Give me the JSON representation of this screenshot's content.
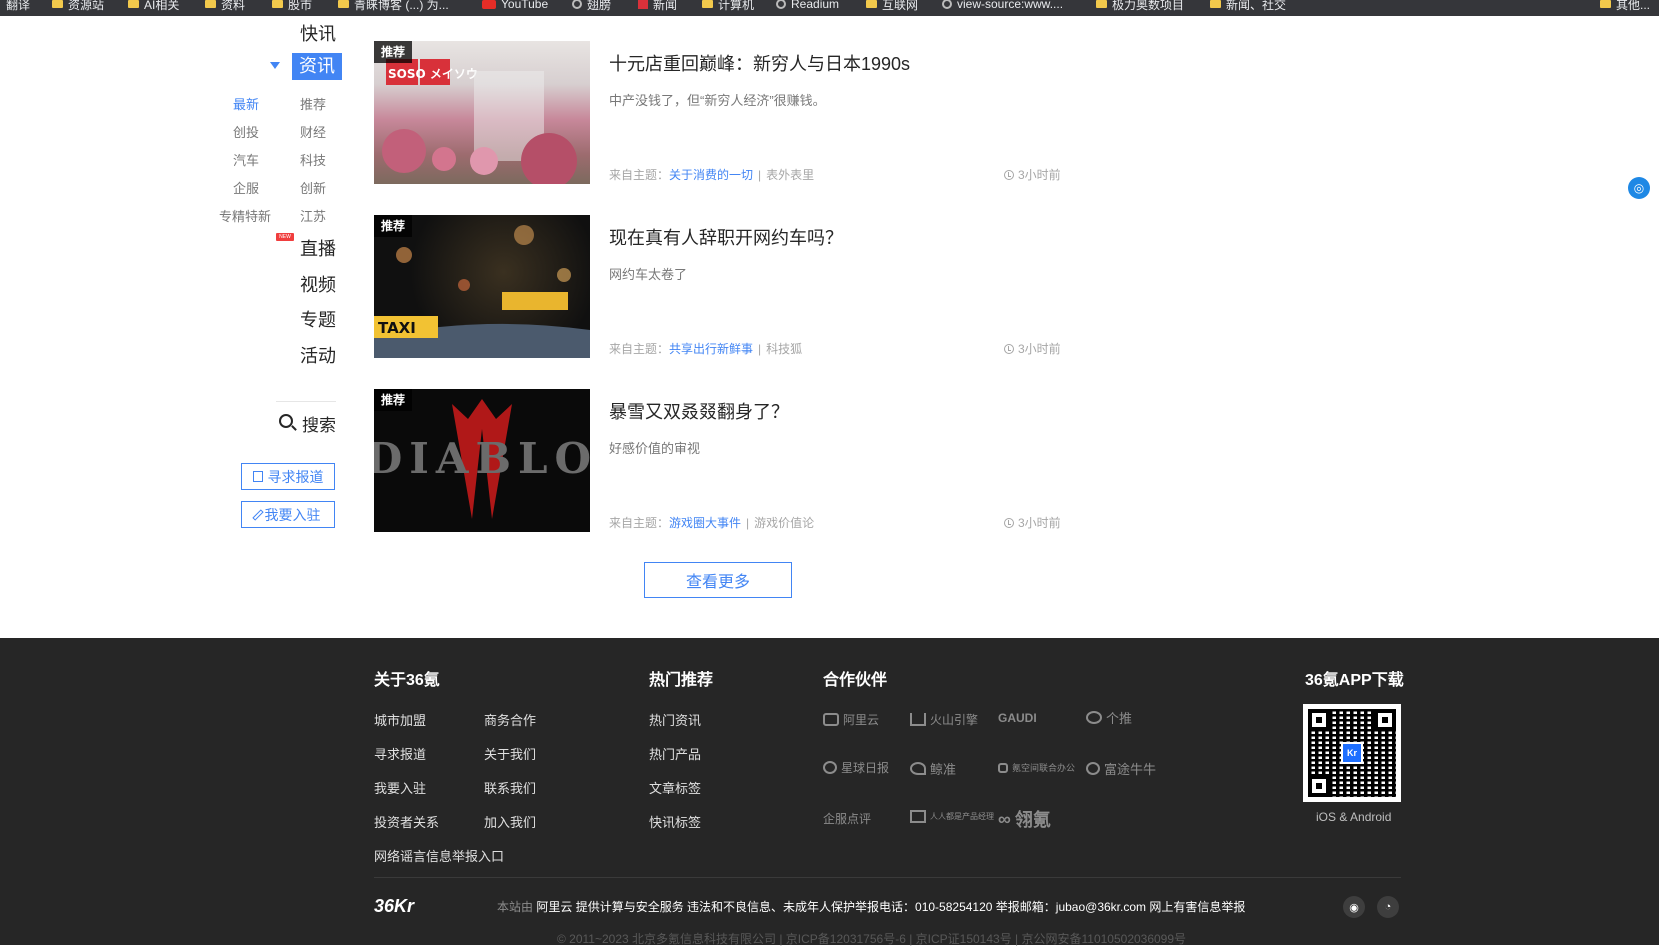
{
  "bookmarks": [
    "翻译",
    "资源站",
    "AI相关",
    "资料",
    "股市",
    "青睐博客 (...) 为...",
    "YouTube",
    "翅膀",
    "新闻",
    "计算机",
    "Readium",
    "互联网",
    "view-source:www....",
    "极力奥数项目",
    "新闻、社交",
    "其他..."
  ],
  "nav": {
    "main": [
      "快讯",
      "资讯",
      "直播",
      "视频",
      "专题",
      "活动"
    ],
    "active": "资讯",
    "new_badge": "NEW",
    "sub_left": [
      "最新",
      "创投",
      "汽车",
      "企服",
      "专精特新"
    ],
    "sub_right": [
      "推荐",
      "财经",
      "科技",
      "创新",
      "江苏"
    ],
    "sub_active": "最新",
    "search": "搜索",
    "btn_report": "寻求报道",
    "btn_join": "我要入驻"
  },
  "articles": [
    {
      "tag": "推荐",
      "title": "十元店重回巅峰：新穷人与日本1990s",
      "desc": "中产没钱了，但“新穷人经济”很赚钱。",
      "from_label": "来自主题：",
      "topic": "关于消费的一切",
      "author": "表外表里",
      "time": "3小时前"
    },
    {
      "tag": "推荐",
      "title": "现在真有人辞职开网约车吗？",
      "desc": "网约车太卷了",
      "from_label": "来自主题：",
      "topic": "共享出行新鲜事",
      "author": "科技狐",
      "time": "3小时前"
    },
    {
      "tag": "推荐",
      "title": "暴雪又双叒叕翻身了？",
      "desc": "好感价值的审视",
      "from_label": "来自主题：",
      "topic": "游戏圈大事件",
      "author": "游戏价值论",
      "time": "3小时前"
    }
  ],
  "thumbs": {
    "a1_sign": "SOSO メイソウ",
    "a2_sign": "TAXI",
    "a3_text": "DIABLO"
  },
  "more": "查看更多",
  "footer": {
    "about_title": "关于36氪",
    "about_links": [
      "城市加盟",
      "商务合作",
      "寻求报道",
      "关于我们",
      "我要入驻",
      "联系我们",
      "投资者关系",
      "加入我们",
      "网络谣言信息举报入口"
    ],
    "hot_title": "热门推荐",
    "hot_links": [
      "热门资讯",
      "热门产品",
      "文章标签",
      "快讯标签"
    ],
    "partner_title": "合作伙伴",
    "partners": [
      "阿里云",
      "火山引擎",
      "GAUDI",
      "个推",
      "星球日报",
      "鲸准",
      "氪空间联合办公",
      "富途牛牛",
      "企服点评",
      "人人都是产品经理",
      "翎氪"
    ],
    "app_title": "36氪APP下载",
    "app_sub": "iOS & Android",
    "logo": "36Kr",
    "notice_dim": "本站由",
    "notice_main": "阿里云 提供计算与安全服务 违法和不良信息、未成年人保护举报电话：010-58254120 举报邮箱：jubao@36kr.com 网上有害信息举报",
    "copyright": "© 2011~2023 北京多氪信息科技有限公司 | 京ICP备12031756号-6 | 京ICP证150143号 | 京公网安备11010502036099号"
  },
  "colors": {
    "accent": "#4285f4",
    "footer_bg": "#262626"
  }
}
